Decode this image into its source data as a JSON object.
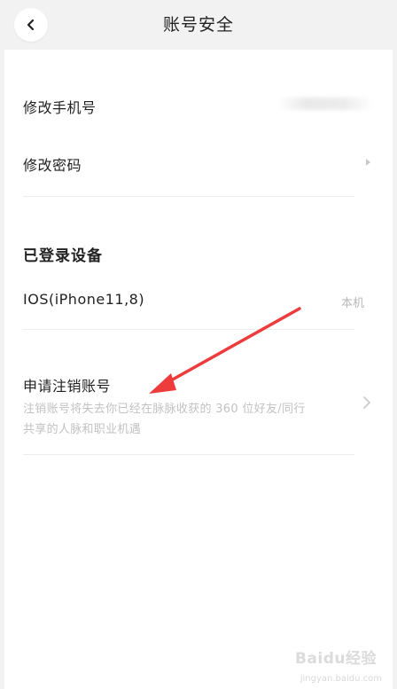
{
  "header": {
    "title": "账号安全",
    "back_icon": "chevron-left-icon"
  },
  "account": {
    "change_phone_label": "修改手机号",
    "change_password_label": "修改密码"
  },
  "devices": {
    "section_title": "已登录设备",
    "items": [
      {
        "name": "IOS(iPhone11,8)",
        "badge": "本机"
      }
    ]
  },
  "deactivate": {
    "label": "申请注销账号",
    "description": "注销账号将失去你已经在脉脉收获的 360 位好友/同行共享的人脉和职业机遇"
  },
  "watermark": {
    "text": "Baidu经验",
    "sub": "jingyan.baidu.com"
  },
  "colors": {
    "annotation_arrow": "#ee3b3b"
  }
}
